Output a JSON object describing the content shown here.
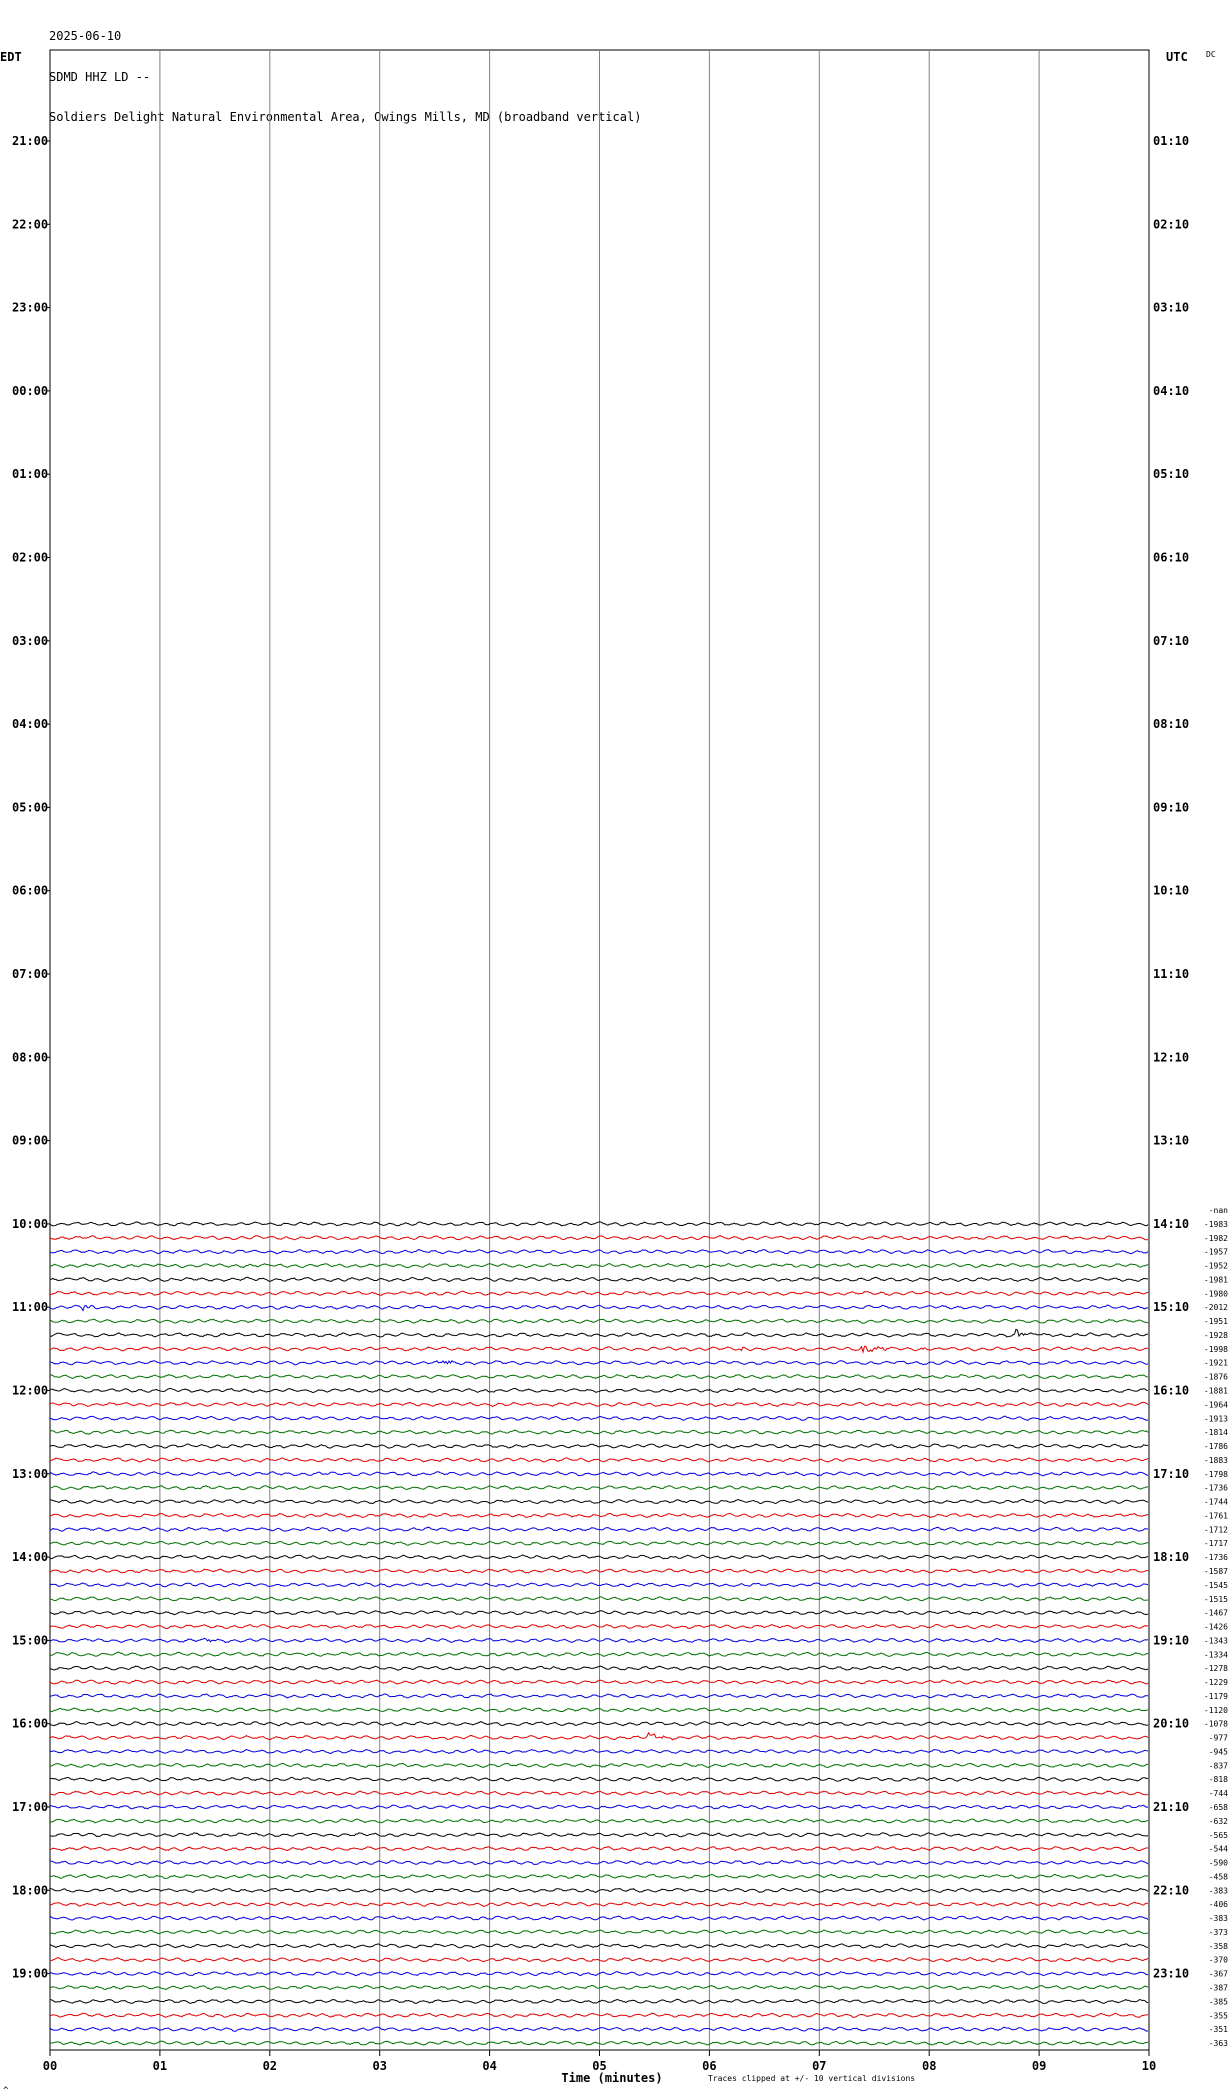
{
  "header": {
    "date": "2025-06-10",
    "station": "SDMD HHZ LD --",
    "location": "Soldiers Delight Natural Environmental Area, Owings Mills, MD (broadband vertical)"
  },
  "corner": {
    "left_zone": "EDT",
    "right_zone": "UTC",
    "dc_label": "DC"
  },
  "footer": {
    "note": "Traces clipped at +/- 10 vertical divisions",
    "corner_mark": "^"
  },
  "colors": {
    "trace_cycle": [
      "#000000",
      "#e00000",
      "#0000e0",
      "#007000"
    ],
    "grid": "#808080"
  },
  "chart_data": {
    "type": "line",
    "xlabel": "Time (minutes)",
    "x_ticks": [
      "00",
      "01",
      "02",
      "03",
      "04",
      "05",
      "06",
      "07",
      "08",
      "09",
      "10"
    ],
    "xlim": [
      0,
      10
    ],
    "left_hour_labels": [
      "21:00",
      "22:00",
      "23:00",
      "00:00",
      "01:00",
      "02:00",
      "03:00",
      "04:00",
      "05:00",
      "06:00",
      "07:00",
      "08:00",
      "09:00",
      "10:00",
      "11:00",
      "12:00",
      "13:00",
      "14:00",
      "15:00",
      "16:00",
      "17:00",
      "18:00",
      "19:00"
    ],
    "right_hour_labels": [
      "01:10",
      "02:10",
      "03:10",
      "04:10",
      "05:10",
      "06:10",
      "07:10",
      "08:10",
      "09:10",
      "10:10",
      "11:10",
      "12:10",
      "13:10",
      "14:10",
      "15:10",
      "16:10",
      "17:10",
      "18:10",
      "19:10",
      "20:10",
      "21:10",
      "22:10",
      "23:10"
    ],
    "traces_per_hour": 6,
    "first_trace_hour_index": 13,
    "trace_offsets": [
      "-nan",
      "-1983",
      "-1982",
      "-1957",
      "-1952",
      "-1981",
      "-1980",
      "-2012",
      "-1951",
      "-1928",
      "-1998",
      "-1921",
      "-1876",
      "-1881",
      "-1964",
      "-1913",
      "-1814",
      "-1786",
      "-1883",
      "-1798",
      "-1736",
      "-1744",
      "-1761",
      "-1712",
      "-1717",
      "-1736",
      "-1587",
      "-1545",
      "-1515",
      "-1467",
      "-1426",
      "-1343",
      "-1334",
      "-1278",
      "-1229",
      "-1179",
      "-1120",
      "-1078",
      "-977",
      "-945",
      "-837",
      "-818",
      "-744",
      "-658",
      "-632",
      "-565",
      "-544",
      "-590",
      "-458",
      "-383",
      "-406",
      "-383",
      "-373",
      "-358",
      "-370",
      "-367",
      "-387",
      "-385",
      "-355",
      "-351",
      "-363"
    ],
    "events": [
      {
        "trace": 6,
        "minute": 0.3,
        "amp": 3
      },
      {
        "trace": 8,
        "minute": 8.8,
        "amp": 5
      },
      {
        "trace": 8,
        "minute": 8.95,
        "amp": 2
      },
      {
        "trace": 9,
        "minute": 6.3,
        "amp": 2
      },
      {
        "trace": 9,
        "minute": 7.4,
        "amp": 5
      },
      {
        "trace": 9,
        "minute": 7.52,
        "amp": 3
      },
      {
        "trace": 9,
        "minute": 7.95,
        "amp": 2
      },
      {
        "trace": 10,
        "minute": 3.55,
        "amp": 4
      },
      {
        "trace": 16,
        "minute": 9.85,
        "amp": 2
      },
      {
        "trace": 30,
        "minute": 1.45,
        "amp": 2
      },
      {
        "trace": 37,
        "minute": 5.45,
        "amp": 8
      }
    ],
    "grid": true
  }
}
